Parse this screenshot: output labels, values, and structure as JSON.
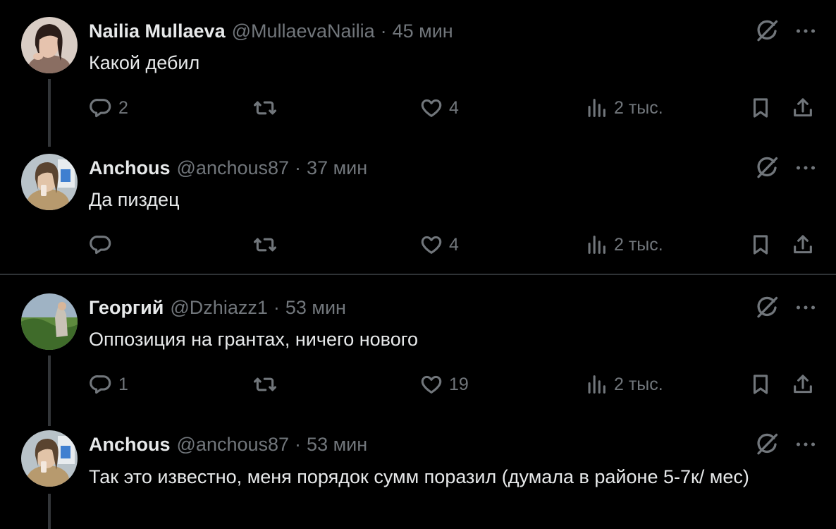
{
  "colors": {
    "background": "#000000",
    "text": "#e7e9ea",
    "muted": "#71767b",
    "divider": "#2f3336"
  },
  "tweets": [
    {
      "name": "Nailia Mullaeva",
      "handle": "@MullaevaNailia",
      "time": "45 мин",
      "text": "Какой дебил",
      "replies": "2",
      "reposts": "",
      "likes": "4",
      "views": "2 тыс."
    },
    {
      "name": "Anchous",
      "handle": "@anchous87",
      "time": "37 мин",
      "text": "Да пиздец",
      "replies": "",
      "reposts": "",
      "likes": "4",
      "views": "2 тыс."
    },
    {
      "name": "Георгий",
      "handle": "@Dzhiazz1",
      "time": "53 мин",
      "text": "Оппозиция на грантах, ничего нового",
      "replies": "1",
      "reposts": "",
      "likes": "19",
      "views": "2 тыс."
    },
    {
      "name": "Anchous",
      "handle": "@anchous87",
      "time": "53 мин",
      "text": "Так это известно, меня порядок сумм поразил (думала в районе 5-7к/ мес)"
    }
  ],
  "separator": "·",
  "icons": {
    "reply": "reply-icon",
    "repost": "repost-icon",
    "like": "heart-icon",
    "views": "views-icon",
    "bookmark": "bookmark-icon",
    "share": "share-icon",
    "grok": "grok-icon",
    "more": "more-icon"
  }
}
